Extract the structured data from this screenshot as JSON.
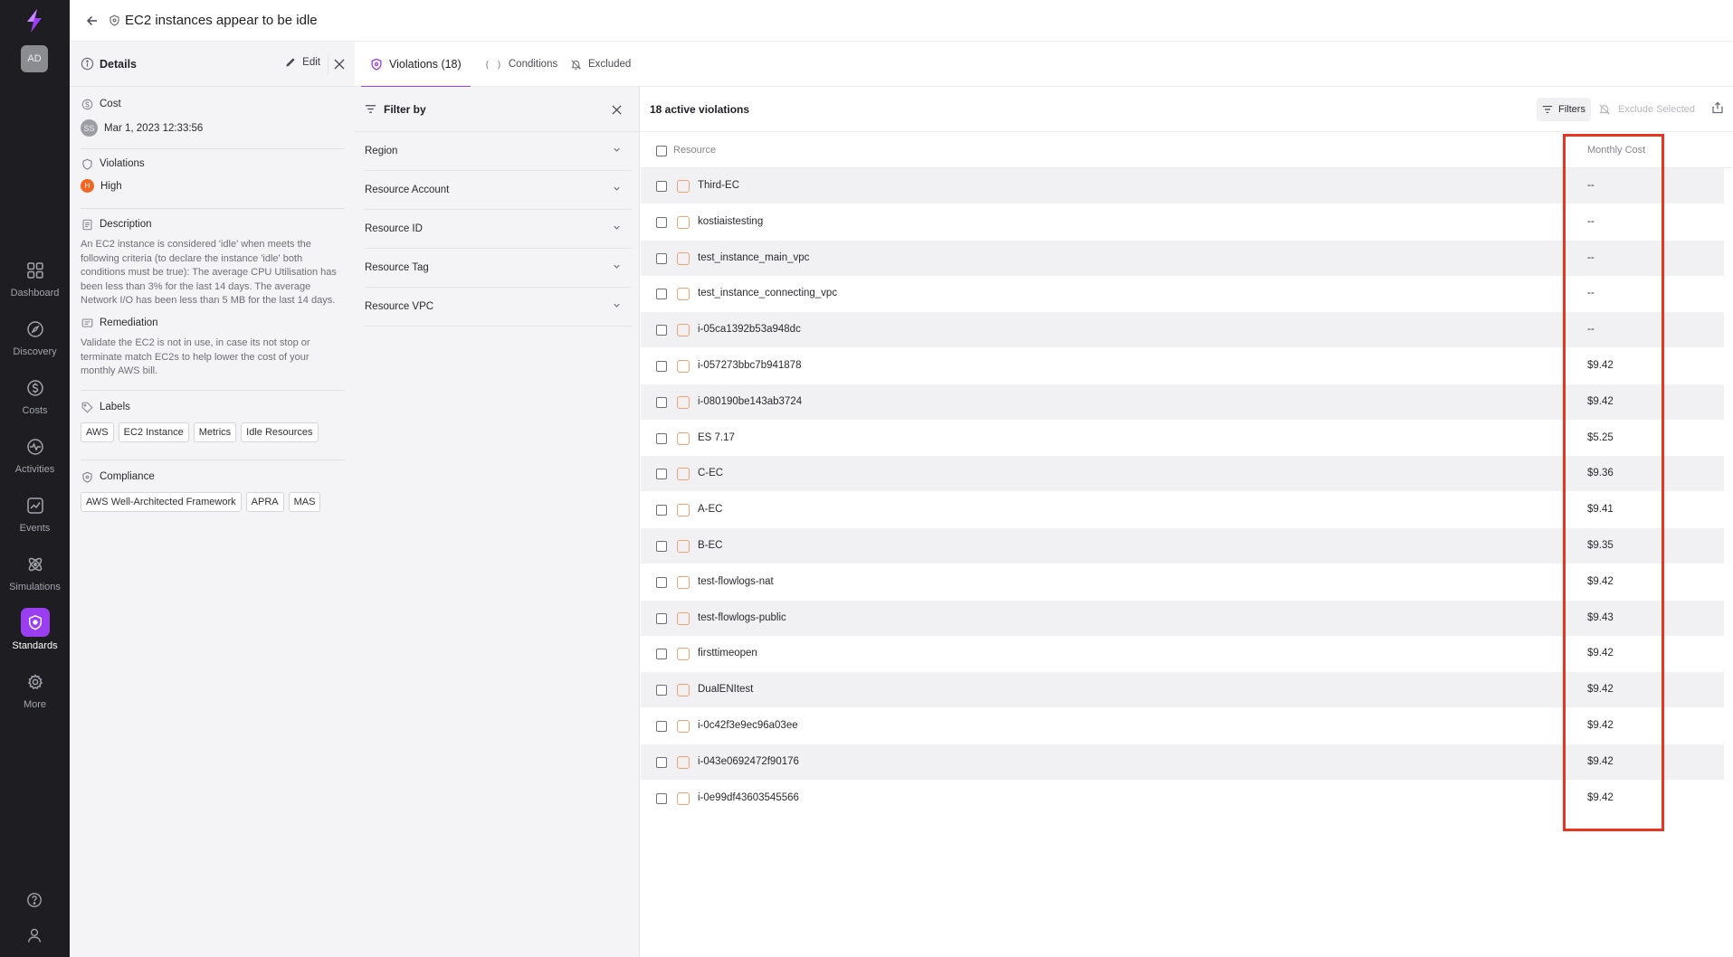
{
  "header": {
    "title": "EC2 instances appear to be idle"
  },
  "rail": {
    "avatar": "AD",
    "items": [
      {
        "label": "Dashboard",
        "icon": "grid-icon"
      },
      {
        "label": "Discovery",
        "icon": "compass-icon"
      },
      {
        "label": "Costs",
        "icon": "dollar-icon"
      },
      {
        "label": "Activities",
        "icon": "activity-icon"
      },
      {
        "label": "Events",
        "icon": "chart-icon"
      },
      {
        "label": "Simulations",
        "icon": "atom-icon"
      },
      {
        "label": "Standards",
        "icon": "shield-icon"
      },
      {
        "label": "More",
        "icon": "gear-icon"
      }
    ]
  },
  "details": {
    "title": "Details",
    "edit_label": "Edit",
    "cost": {
      "title": "Cost",
      "avatar": "SS",
      "date": "Mar 1, 2023 12:33:56"
    },
    "violations": {
      "title": "Violations",
      "severity_letter": "H",
      "severity": "High"
    },
    "description": {
      "title": "Description",
      "text": "An EC2 instance is considered 'idle' when meets the following criteria (to declare the instance 'idle' both conditions must be true): The average CPU Utilisation has been less than 3% for the last 14 days. The average Network I/O has been less than 5 MB for the last 14 days."
    },
    "remediation": {
      "title": "Remediation",
      "text": "Validate the EC2 is not in use, in case its not stop or terminate match EC2s to help lower the cost of your monthly AWS bill."
    },
    "labels": {
      "title": "Labels",
      "items": [
        "AWS",
        "EC2 Instance",
        "Metrics",
        "Idle Resources"
      ]
    },
    "compliance": {
      "title": "Compliance",
      "items": [
        "AWS Well-Architected Framework",
        "APRA",
        "MAS"
      ]
    }
  },
  "tabs": [
    {
      "label": "Violations (18)",
      "active": true
    },
    {
      "label": "Conditions",
      "active": false
    },
    {
      "label": "Excluded",
      "active": false
    }
  ],
  "filter": {
    "title": "Filter by",
    "groups": [
      "Region",
      "Resource Account",
      "Resource ID",
      "Resource Tag",
      "Resource VPC"
    ]
  },
  "violations": {
    "count_label": "18 active violations",
    "filters_label": "Filters",
    "exclude_label": "Exclude Selected",
    "columns": {
      "resource": "Resource",
      "cost": "Monthly Cost"
    },
    "rows": [
      {
        "name": "Third-EC",
        "cost": "--"
      },
      {
        "name": "kostiaistesting",
        "cost": "--"
      },
      {
        "name": "test_instance_main_vpc",
        "cost": "--"
      },
      {
        "name": "test_instance_connecting_vpc",
        "cost": "--"
      },
      {
        "name": "i-05ca1392b53a948dc",
        "cost": "--"
      },
      {
        "name": "i-057273bbc7b941878",
        "cost": "$9.42"
      },
      {
        "name": "i-080190be143ab3724",
        "cost": "$9.42"
      },
      {
        "name": "ES 7.17",
        "cost": "$5.25"
      },
      {
        "name": "C-EC",
        "cost": "$9.36"
      },
      {
        "name": "A-EC",
        "cost": "$9.41"
      },
      {
        "name": "B-EC",
        "cost": "$9.35"
      },
      {
        "name": "test-flowlogs-nat",
        "cost": "$9.42"
      },
      {
        "name": "test-flowlogs-public",
        "cost": "$9.43"
      },
      {
        "name": "firsttimeopen",
        "cost": "$9.42"
      },
      {
        "name": "DualENItest",
        "cost": "$9.42"
      },
      {
        "name": "i-0c42f3e9ec96a03ee",
        "cost": "$9.42"
      },
      {
        "name": "i-043e0692472f90176",
        "cost": "$9.42"
      },
      {
        "name": "i-0e99df43603545566",
        "cost": "$9.42"
      }
    ]
  },
  "colors": {
    "accent": "#9b3df0",
    "severity_high": "#f2641f",
    "highlight": "#e8351f",
    "rail": "#1d1d22"
  }
}
